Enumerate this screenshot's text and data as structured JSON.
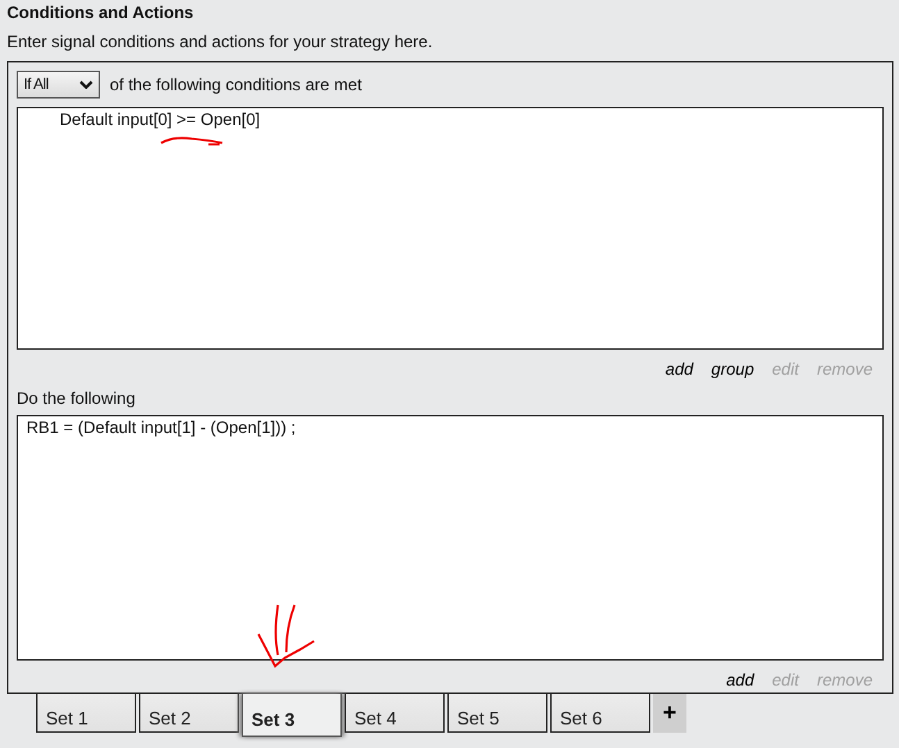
{
  "header": {
    "title": "Conditions and Actions",
    "description": "Enter signal conditions and actions for your strategy here."
  },
  "conditions": {
    "mode": "If All",
    "mode_caption": "of the following conditions are met",
    "items": [
      "Default input[0] >= Open[0]"
    ],
    "links": [
      {
        "label": "add",
        "disabled": false
      },
      {
        "label": "group",
        "disabled": false
      },
      {
        "label": "edit",
        "disabled": true
      },
      {
        "label": "remove",
        "disabled": true
      }
    ]
  },
  "actions": {
    "caption": "Do the following",
    "items": [
      "RB1 = (Default input[1] - (Open[1])) ;"
    ],
    "links": [
      {
        "label": "add",
        "disabled": false
      },
      {
        "label": "edit",
        "disabled": true
      },
      {
        "label": "remove",
        "disabled": true
      }
    ]
  },
  "tabs": [
    {
      "label": "Set 1",
      "selected": false
    },
    {
      "label": "Set 2",
      "selected": false
    },
    {
      "label": "Set 3",
      "selected": true
    },
    {
      "label": "Set 4",
      "selected": false
    },
    {
      "label": "Set 5",
      "selected": false
    },
    {
      "label": "Set 6",
      "selected": false
    }
  ],
  "add_tab": "+"
}
